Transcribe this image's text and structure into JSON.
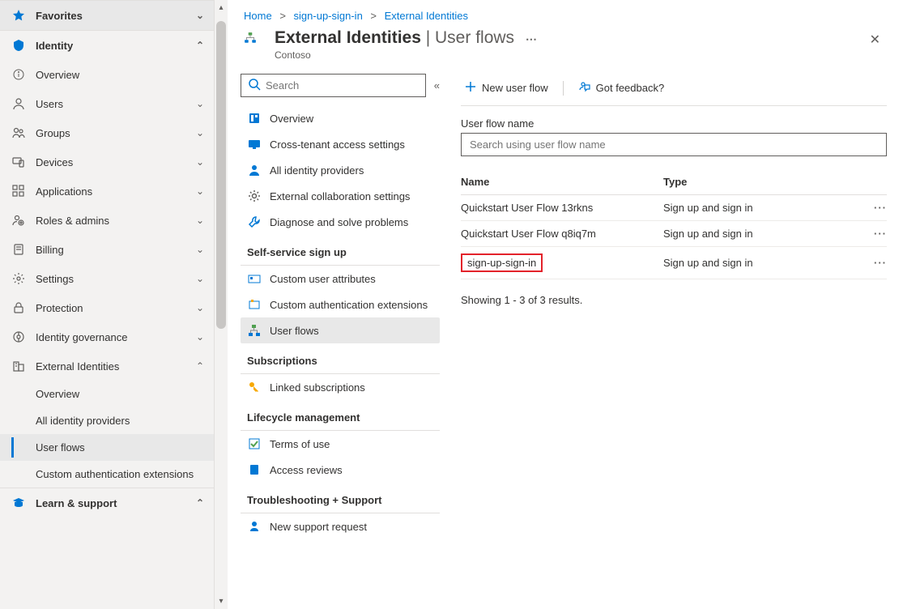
{
  "colors": {
    "accent": "#0078d4",
    "highlight": "#e3222a"
  },
  "sidebar": {
    "favorites": {
      "label": "Favorites"
    },
    "identity": {
      "label": "Identity",
      "items": [
        {
          "label": "Overview"
        },
        {
          "label": "Users"
        },
        {
          "label": "Groups"
        },
        {
          "label": "Devices"
        },
        {
          "label": "Applications"
        },
        {
          "label": "Roles & admins"
        },
        {
          "label": "Billing"
        },
        {
          "label": "Settings"
        },
        {
          "label": "Protection"
        },
        {
          "label": "Identity governance"
        },
        {
          "label": "External Identities"
        }
      ],
      "extSub": [
        {
          "label": "Overview"
        },
        {
          "label": "All identity providers"
        },
        {
          "label": "User flows"
        },
        {
          "label": "Custom authentication extensions"
        }
      ]
    },
    "learn": {
      "label": "Learn & support"
    }
  },
  "breadcrumb": [
    {
      "label": "Home"
    },
    {
      "label": "sign-up-sign-in"
    },
    {
      "label": "External Identities"
    }
  ],
  "header": {
    "title_strong": "External Identities",
    "title_sep": " | ",
    "title_light": "User flows",
    "subtitle": "Contoso"
  },
  "innerNav": {
    "search_placeholder": "Search",
    "top": [
      {
        "label": "Overview"
      },
      {
        "label": "Cross-tenant access settings"
      },
      {
        "label": "All identity providers"
      },
      {
        "label": "External collaboration settings"
      },
      {
        "label": "Diagnose and solve problems"
      }
    ],
    "sec_selfservice": "Self-service sign up",
    "selfservice": [
      {
        "label": "Custom user attributes"
      },
      {
        "label": "Custom authentication extensions"
      },
      {
        "label": "User flows"
      }
    ],
    "sec_subs": "Subscriptions",
    "subs": [
      {
        "label": "Linked subscriptions"
      }
    ],
    "sec_life": "Lifecycle management",
    "life": [
      {
        "label": "Terms of use"
      },
      {
        "label": "Access reviews"
      }
    ],
    "sec_trouble": "Troubleshooting + Support",
    "trouble": [
      {
        "label": "New support request"
      }
    ]
  },
  "toolbar": {
    "new_flow": "New user flow",
    "feedback": "Got feedback?"
  },
  "pane": {
    "field_label": "User flow name",
    "field_placeholder": "Search using user flow name",
    "col_name": "Name",
    "col_type": "Type",
    "rows": [
      {
        "name": "Quickstart User Flow 13rkns",
        "type": "Sign up and sign in"
      },
      {
        "name": "Quickstart User Flow q8iq7m",
        "type": "Sign up and sign in"
      },
      {
        "name": "sign-up-sign-in",
        "type": "Sign up and sign in",
        "highlight": true
      }
    ],
    "results": "Showing 1 - 3 of 3 results."
  }
}
